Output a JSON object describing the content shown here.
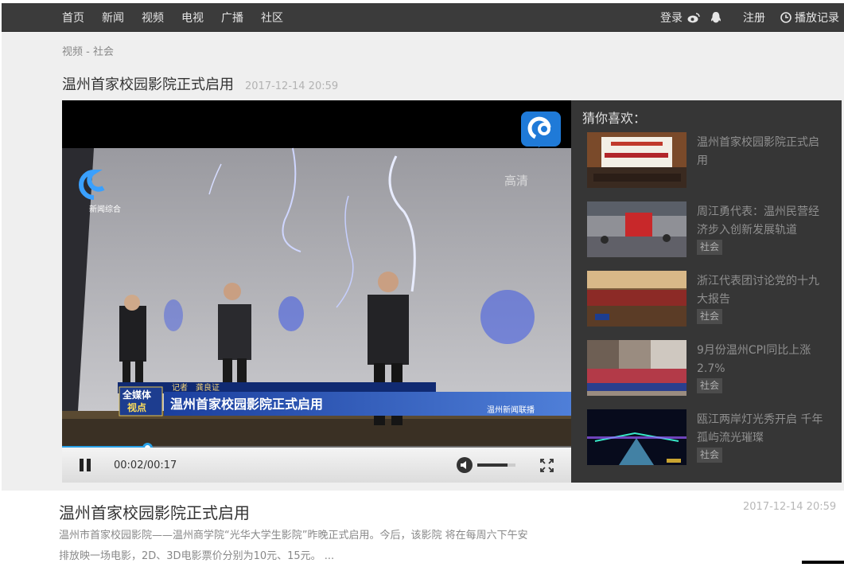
{
  "nav": {
    "items": [
      "首页",
      "新闻",
      "视频",
      "电视",
      "广播",
      "社区"
    ],
    "login": "登录",
    "register": "注册",
    "history": "播放记录"
  },
  "breadcrumb": {
    "section": "视频",
    "sep": " - ",
    "category": "社会"
  },
  "video": {
    "title": "温州首家校园影院正式启用",
    "date": "2017-12-14 20:59",
    "overlay": {
      "channel_name": "新闻综合",
      "hd_label": "高清",
      "reporter": "记者　龚良证",
      "media_badge_line1": "全媒体",
      "media_badge_line2": "视点",
      "caption": "温州首家校园影院正式启用",
      "program": "温州新闻联播"
    },
    "player": {
      "time": "00:02/00:17",
      "progress": 0.1666,
      "volume": 0.8
    }
  },
  "sidebar": {
    "heading": "猜你喜欢：",
    "items": [
      {
        "title": "温州首家校园影院正式启用",
        "tag": ""
      },
      {
        "title": "周江勇代表：温州民营经济步入创新发展轨道",
        "tag": "社会"
      },
      {
        "title": "浙江代表团讨论党的十九大报告",
        "tag": "社会"
      },
      {
        "title": "9月份温州CPI同比上涨2.7%",
        "tag": "社会"
      },
      {
        "title": "瓯江两岸灯光秀开启 千年孤屿流光璀璨",
        "tag": "社会"
      }
    ]
  },
  "article": {
    "title": "温州首家校园影院正式启用",
    "date": "2017-12-14 20:59",
    "desc_line1": "温州市首家校园影院——温州商学院“光华大学生影院”昨晚正式启用。今后，该影院 将在每周六下午安",
    "desc_line2": "排放映一场电影，2D、3D电影票价分别为10元、15元。 ..."
  },
  "colors": {
    "accent": "#29a0e6",
    "topbar": "#3b3b3b",
    "sidebar": "#363636"
  }
}
